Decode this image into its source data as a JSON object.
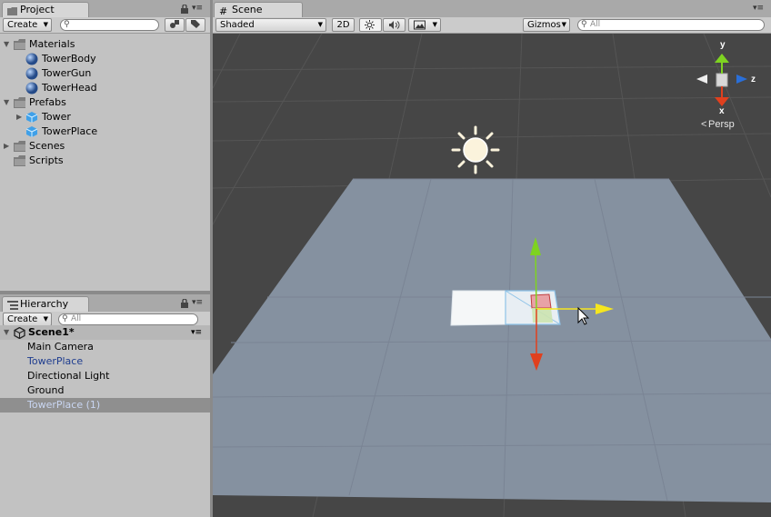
{
  "project": {
    "tab_label": "Project",
    "create_label": "Create",
    "search_placeholder": "",
    "tree": [
      {
        "label": "Materials"
      },
      {
        "label": "TowerBody"
      },
      {
        "label": "TowerGun"
      },
      {
        "label": "TowerHead"
      },
      {
        "label": "Prefabs"
      },
      {
        "label": "Tower"
      },
      {
        "label": "TowerPlace"
      },
      {
        "label": "Scenes"
      },
      {
        "label": "Scripts"
      }
    ]
  },
  "hierarchy": {
    "tab_label": "Hierarchy",
    "create_label": "Create",
    "search_placeholder": "All",
    "scene_name": "Scene1*",
    "items": [
      {
        "label": "Main Camera",
        "color": "#000000"
      },
      {
        "label": "TowerPlace",
        "color": "#1f3d8f"
      },
      {
        "label": "Directional Light",
        "color": "#000000"
      },
      {
        "label": "Ground",
        "color": "#000000"
      },
      {
        "label": "TowerPlace (1)",
        "color": "#c9d6f2",
        "selected": true
      }
    ]
  },
  "scene": {
    "tab_label": "Scene",
    "shading_mode": "Shaded",
    "mode_2d": "2D",
    "gizmos_label": "Gizmos",
    "search_placeholder": "All",
    "gizmo": {
      "y": "y",
      "z": "z",
      "x": "x",
      "projection": "Persp"
    }
  },
  "colors": {
    "scene_bg": "#464646",
    "ground": "#8591a0",
    "axis_x": "#e0401e",
    "axis_y": "#7ed321",
    "axis_z": "#2a6fd8",
    "axis_handle": "#f5e61f",
    "selected_text": "#c9d6f2",
    "prefab_text": "#1f3d8f"
  }
}
